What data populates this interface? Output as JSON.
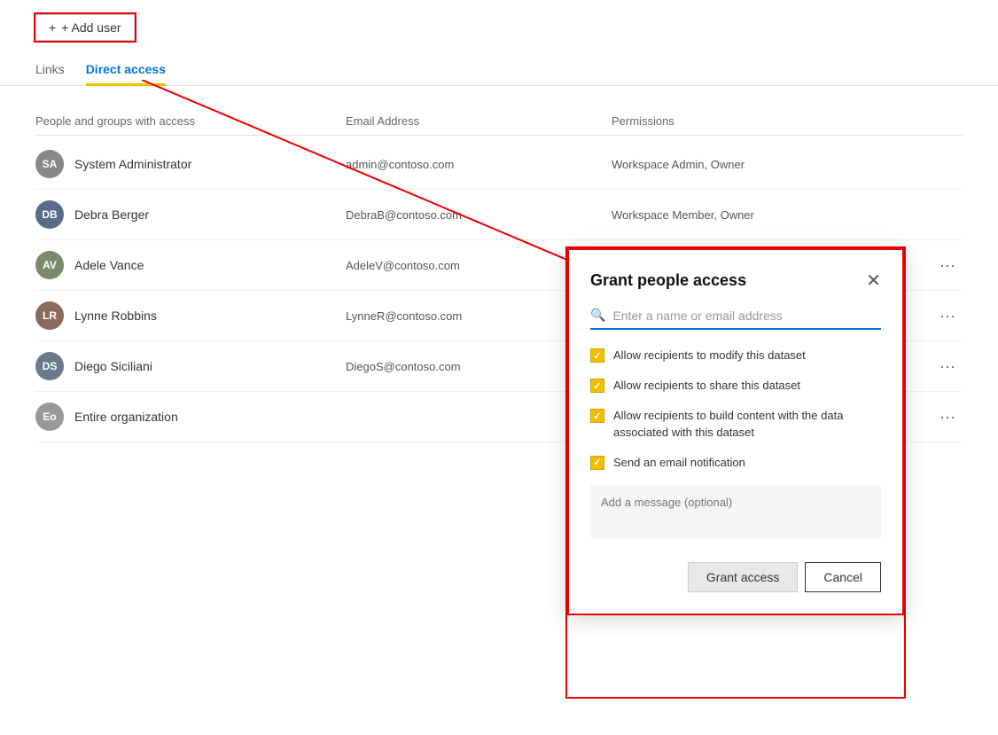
{
  "header": {
    "add_user_label": "+ Add user"
  },
  "tabs": {
    "links": "Links",
    "direct_access": "Direct access"
  },
  "table": {
    "columns": [
      "People and groups with access",
      "Email Address",
      "Permissions"
    ],
    "rows": [
      {
        "initials": "SA",
        "name": "System Administrator",
        "email": "admin@contoso.com",
        "permissions": "Workspace Admin, Owner",
        "avatar_color": "#888"
      },
      {
        "initials": "DB",
        "name": "Debra Berger",
        "email": "DebraB@contoso.com",
        "permissions": "Workspace Member, Owner",
        "avatar_color": "#5a6a8a"
      },
      {
        "initials": "AV",
        "name": "Adele Vance",
        "email": "AdeleV@contoso.com",
        "permissions": "",
        "show_reshare": true,
        "avatar_color": "#7a8a6a"
      },
      {
        "initials": "LR",
        "name": "Lynne Robbins",
        "email": "LynneR@contoso.com",
        "permissions": "",
        "show_reshare": false,
        "avatar_color": "#8a6a5a"
      },
      {
        "initials": "DS",
        "name": "Diego Siciliani",
        "email": "DiegoS@contoso.com",
        "permissions": "",
        "show_reshare": false,
        "avatar_color": "#6a7a8a"
      },
      {
        "initials": "Eo",
        "name": "Entire organization",
        "email": "",
        "permissions": "",
        "show_reshare": false,
        "avatar_color": "#999"
      }
    ]
  },
  "dialog": {
    "title": "Grant people access",
    "search_placeholder": "Enter a name or email address",
    "checkboxes": [
      {
        "label": "Allow recipients to modify this dataset",
        "checked": true
      },
      {
        "label": "Allow recipients to share this dataset",
        "checked": true
      },
      {
        "label": "Allow recipients to build content with the data associated with this dataset",
        "checked": true
      },
      {
        "label": "Send an email notification",
        "checked": true
      }
    ],
    "message_placeholder": "Add a message (optional)",
    "grant_label": "Grant access",
    "cancel_label": "Cancel"
  }
}
